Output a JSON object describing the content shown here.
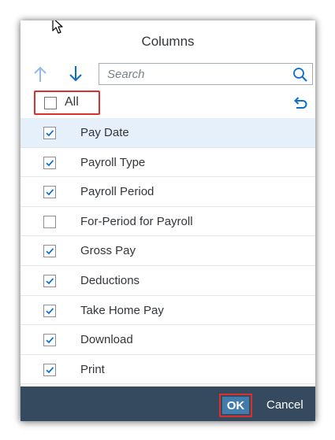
{
  "dialog": {
    "title": "Columns",
    "search": {
      "placeholder": "Search",
      "value": ""
    },
    "select_all": {
      "label": "All",
      "checked": false
    },
    "columns": [
      {
        "label": "Pay Date",
        "checked": true,
        "selected": true
      },
      {
        "label": "Payroll Type",
        "checked": true,
        "selected": false
      },
      {
        "label": "Payroll Period",
        "checked": true,
        "selected": false
      },
      {
        "label": "For-Period for Payroll",
        "checked": false,
        "selected": false
      },
      {
        "label": "Gross Pay",
        "checked": true,
        "selected": false
      },
      {
        "label": "Deductions",
        "checked": true,
        "selected": false
      },
      {
        "label": "Take Home Pay",
        "checked": true,
        "selected": false
      },
      {
        "label": "Download",
        "checked": true,
        "selected": false
      },
      {
        "label": "Print",
        "checked": true,
        "selected": false
      }
    ],
    "footer": {
      "ok_label": "OK",
      "cancel_label": "Cancel"
    }
  },
  "icons": {
    "move_up": "arrow-up-icon",
    "move_down": "arrow-down-icon",
    "search": "search-icon",
    "reset": "undo-icon"
  },
  "colors": {
    "accent": "#0a6ed1",
    "footer_bg": "#354a5f",
    "ok_bg": "#427cac",
    "highlight_box": "#d9322e",
    "selected_row": "#e5f0fa"
  }
}
